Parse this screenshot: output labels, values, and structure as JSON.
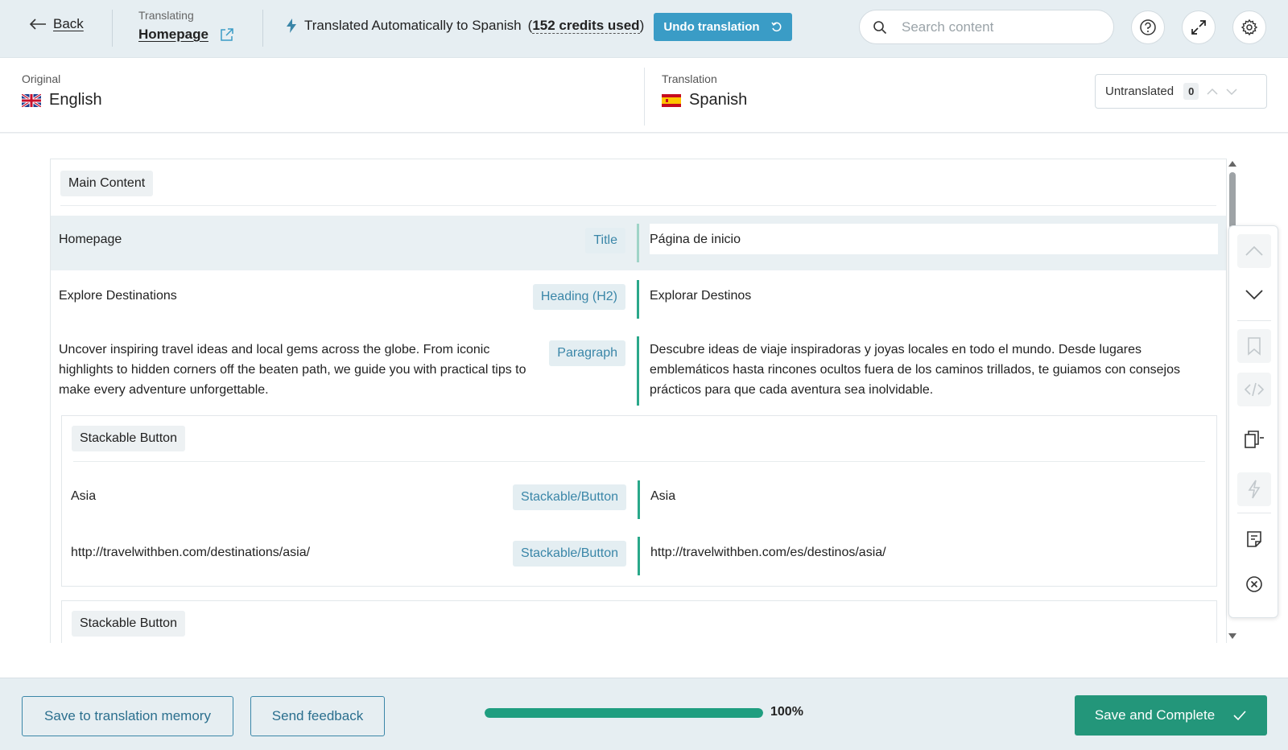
{
  "topbar": {
    "back_label": "Back",
    "translating_label": "Translating",
    "page_name": "Homepage",
    "auto_text": "Translated Automatically to Spanish",
    "credits_text": "152 credits used",
    "undo_label": "Undo translation",
    "search_placeholder": "Search content"
  },
  "languages": {
    "original_label": "Original",
    "original_name": "English",
    "translation_label": "Translation",
    "translation_name": "Spanish",
    "untranslated_label": "Untranslated",
    "untranslated_count": "0"
  },
  "content": {
    "section_title": "Main Content",
    "rows": [
      {
        "source": "Homepage",
        "type": "Title",
        "target": "Página de inicio"
      },
      {
        "source": "Explore Destinations",
        "type": "Heading (H2)",
        "target": "Explorar Destinos"
      },
      {
        "source": "Uncover inspiring travel ideas and local gems across the globe. From iconic highlights to hidden corners off the beaten path, we guide you with practical tips to make every adventure unforgettable.",
        "type": "Paragraph",
        "target": "Descubre ideas de viaje inspiradoras y joyas locales en todo el mundo. Desde lugares emblemáticos hasta rincones ocultos fuera de los caminos trillados, te guiamos con consejos prácticos para que cada aventura sea inolvidable."
      }
    ],
    "stackable_1": {
      "title": "Stackable Button",
      "rows": [
        {
          "source": "Asia",
          "type": "Stackable/Button",
          "target": "Asia"
        },
        {
          "source": "http://travelwithben.com/destinations/asia/",
          "type": "Stackable/Button",
          "target": "http://travelwithben.com/es/destinos/asia/"
        }
      ]
    },
    "stackable_2": {
      "title": "Stackable Button"
    }
  },
  "tools": [
    "chevron-up-icon",
    "chevron-down-icon",
    "bookmark-icon",
    "code-icon",
    "copy-source-icon",
    "lightning-icon",
    "notes-icon",
    "clear-icon"
  ],
  "footer": {
    "memory_label": "Save to translation memory",
    "feedback_label": "Send feedback",
    "progress": 1.0,
    "progress_label": "100%",
    "save_label": "Save and Complete"
  },
  "colors": {
    "accent": "#23967a",
    "primary_blue": "#3a9cc6",
    "topbar_bg": "#e6eef2"
  }
}
